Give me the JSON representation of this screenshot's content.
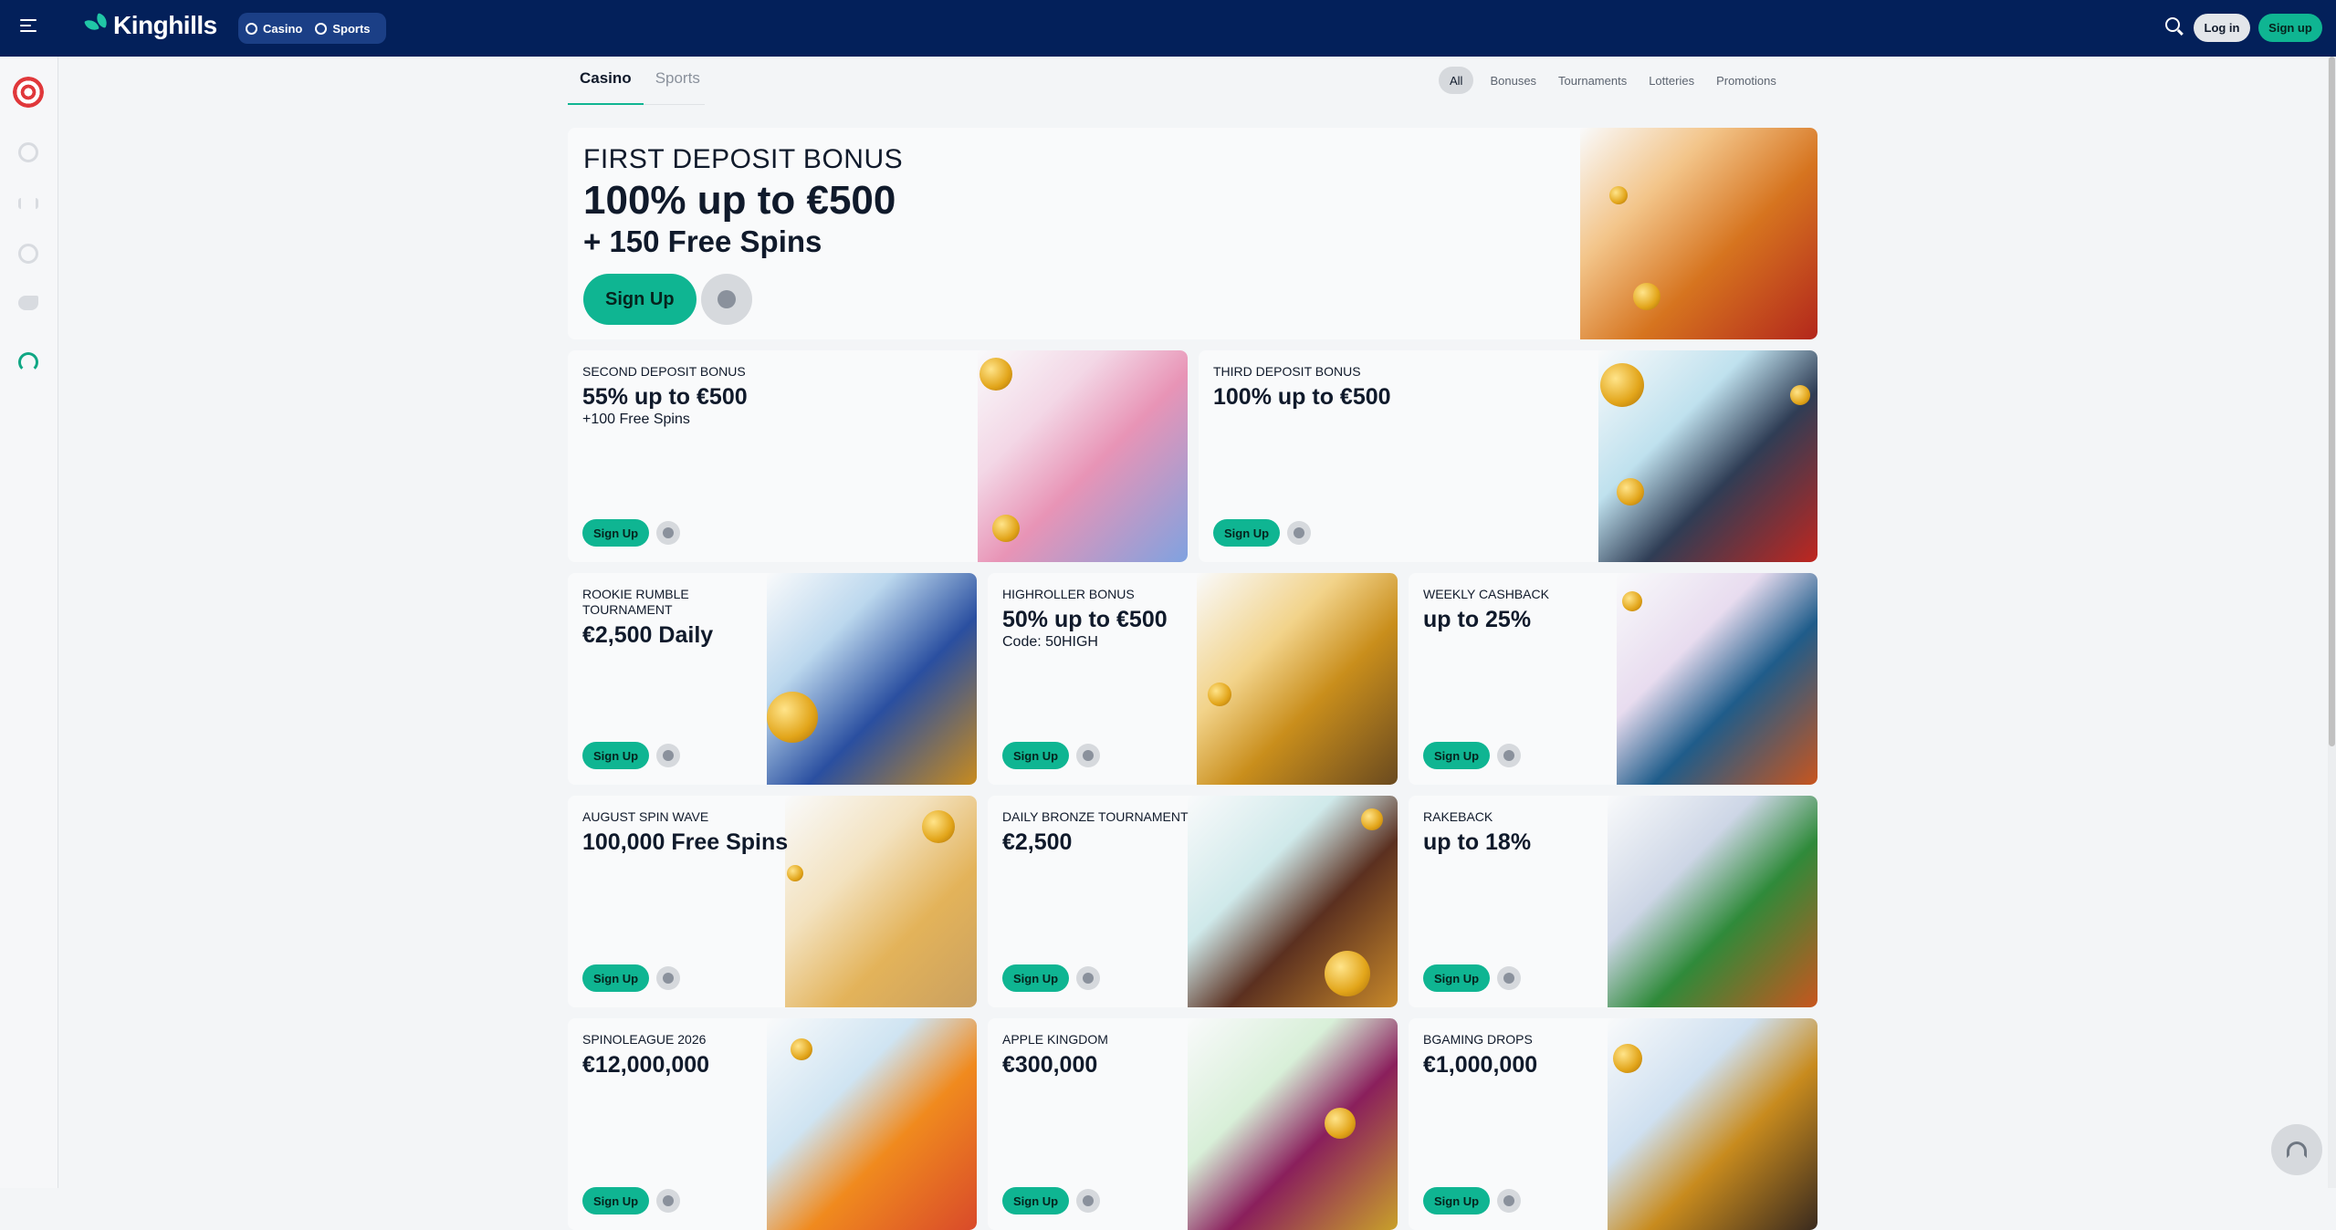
{
  "header": {
    "brand": "Kinghills",
    "nav": [
      {
        "label": "Casino",
        "icon": "casino-icon"
      },
      {
        "label": "Sports",
        "icon": "sports-icon"
      }
    ],
    "login_label": "Log in",
    "signup_label": "Sign up"
  },
  "sidebar": {
    "items": [
      "dart-icon",
      "football-icon",
      "dumbbell-icon",
      "basketball-icon",
      "horse-icon",
      "support-icon"
    ]
  },
  "tabs": [
    "Casino",
    "Sports"
  ],
  "filters": [
    "All",
    "Bonuses",
    "Tournaments",
    "Lotteries",
    "Promotions"
  ],
  "hero": {
    "title": "FIRST DEPOSIT BONUS",
    "headline": "100% up to €500",
    "subline": "+ 150 Free Spins",
    "cta": "Sign Up"
  },
  "promos": [
    {
      "title": "SECOND DEPOSIT BONUS",
      "value": "55% up to €500",
      "sub": "+100 Free Spins",
      "cta": "Sign Up"
    },
    {
      "title": "THIRD DEPOSIT BONUS",
      "value": "100% up to €500",
      "sub": "",
      "cta": "Sign Up"
    },
    {
      "title": "ROOKIE RUMBLE TOURNAMENT",
      "value": "€2,500 Daily",
      "sub": "",
      "cta": "Sign Up"
    },
    {
      "title": "HIGHROLLER BONUS",
      "value": "50% up to €500",
      "sub": "Code: 50HIGH",
      "cta": "Sign Up"
    },
    {
      "title": "WEEKLY CASHBACK",
      "value": "up to 25%",
      "sub": "",
      "cta": "Sign Up"
    },
    {
      "title": "AUGUST SPIN WAVE",
      "value": "100,000 Free Spins",
      "sub": "",
      "cta": "Sign Up"
    },
    {
      "title": "DAILY BRONZE TOURNAMENT",
      "value": "€2,500",
      "sub": "",
      "cta": "Sign Up"
    },
    {
      "title": "RAKEBACK",
      "value": "up to 18%",
      "sub": "",
      "cta": "Sign Up"
    },
    {
      "title": "SPINOLEAGUE 2026",
      "value": "€12,000,000",
      "sub": "",
      "cta": "Sign Up"
    },
    {
      "title": "APPLE KINGDOM",
      "value": "€300,000",
      "sub": "",
      "cta": "Sign Up"
    },
    {
      "title": "BGAMING DROPS",
      "value": "€1,000,000",
      "sub": "",
      "cta": "Sign Up"
    }
  ],
  "colors": {
    "header": "#03205a",
    "accent": "#0fb592",
    "card": "#f9fafb"
  }
}
